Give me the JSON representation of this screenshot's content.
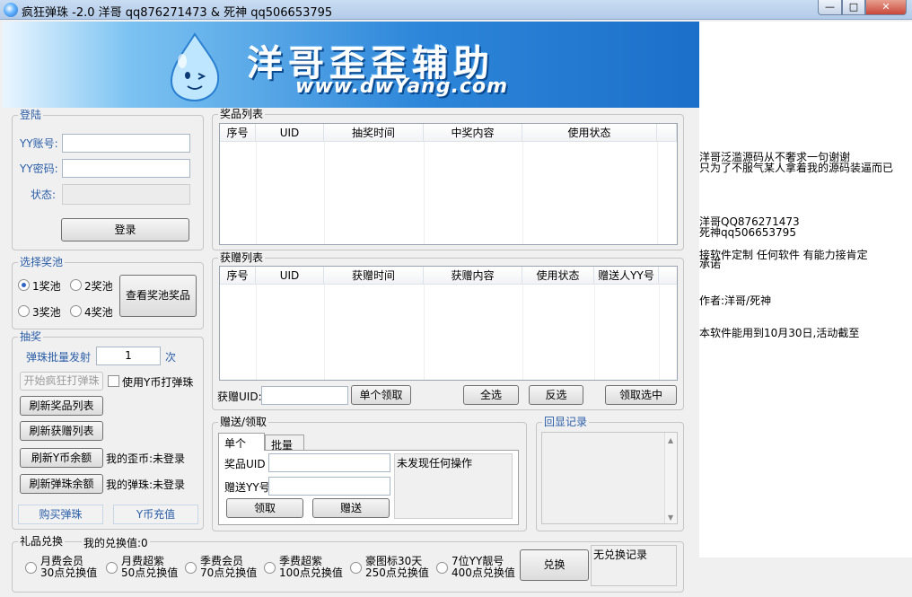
{
  "window": {
    "title": "疯狂弹珠 -2.0    洋哥 qq876271473 & 死神 qq506653795",
    "min_label": "—",
    "max_label": "□",
    "close_label": "✕"
  },
  "banner": {
    "title": "洋哥歪歪辅助",
    "url": "www.dwYang.com",
    "mascot_icon": "water-drop-mascot"
  },
  "login": {
    "legend": "登陆",
    "account_label": "YY账号:",
    "account_value": "",
    "password_label": "YY密码:",
    "password_value": "",
    "status_label": "状态:",
    "status_value": "",
    "login_button": "登录"
  },
  "pool": {
    "legend": "选择奖池",
    "options": [
      "1奖池",
      "2奖池",
      "3奖池",
      "4奖池"
    ],
    "selected_index": 0,
    "view_button": "查看奖池奖品"
  },
  "draw": {
    "legend": "抽奖",
    "batch_label": "弹珠批量发射",
    "batch_value": "1",
    "batch_unit": "次",
    "start_button": "开始疯狂打弹珠",
    "use_ycoin_label": "使用Y币打弹珠",
    "refresh_prizes_button": "刷新奖品列表",
    "refresh_gifts_button": "刷新获赠列表",
    "refresh_ycoin_button": "刷新Y币余额",
    "my_coins_label": "我的歪币:未登录",
    "refresh_balls_button": "刷新弹珠余额",
    "my_balls_label": "我的弹珠:未登录",
    "buy_balls_button": "购买弹珠",
    "ycoin_recharge_button": "Y币充值"
  },
  "prize_list": {
    "legend": "奖品列表",
    "columns": [
      "序号",
      "UID",
      "抽奖时间",
      "中奖内容",
      "使用状态"
    ]
  },
  "gift_list": {
    "legend": "获赠列表",
    "columns": [
      "序号",
      "UID",
      "获赠时间",
      "获赠内容",
      "使用状态",
      "赠送人YY号"
    ],
    "uid_label": "获赠UID:",
    "uid_value": "",
    "single_claim_button": "单个领取",
    "select_all_button": "全选",
    "invert_button": "反选",
    "claim_selected_button": "领取选中"
  },
  "give": {
    "legend": "赠送/领取",
    "tabs": [
      "单个",
      "批量"
    ],
    "prize_uid_label": "奖品UID",
    "prize_uid_value": "",
    "recipient_label": "赠送YY号",
    "recipient_value": "",
    "status_text": "未发现任何操作",
    "claim_button": "领取",
    "give_button": "赠送"
  },
  "echo": {
    "legend": "回显记录"
  },
  "exchange": {
    "legend": "礼品兑换",
    "my_value": "我的兑换值:0",
    "options": [
      {
        "line1": "月费会员",
        "line2": "30点兑换值"
      },
      {
        "line1": "月费超紫",
        "line2": "50点兑换值"
      },
      {
        "line1": "季费会员",
        "line2": "70点兑换值"
      },
      {
        "line1": "季费超紫",
        "line2": "100点兑换值"
      },
      {
        "line1": "豪图标30天",
        "line2": "250点兑换值"
      },
      {
        "line1": "7位YY靓号",
        "line2": "400点兑换值"
      }
    ],
    "button": "兑换",
    "record_text": "无兑换记录"
  },
  "info": {
    "line1": "洋哥泛滥源码从不奢求一句谢谢",
    "line2": "只为了不服气某人拿着我的源码装逼而已",
    "qq1": "洋哥QQ876271473",
    "qq2": "死神qq506653795",
    "custom": "接软件定制   任何软件    有能力接肯定",
    "custom2": "承诺",
    "authors": "作者:洋哥/死神",
    "expiry": "本软件能用到10月30日,活动截至"
  }
}
